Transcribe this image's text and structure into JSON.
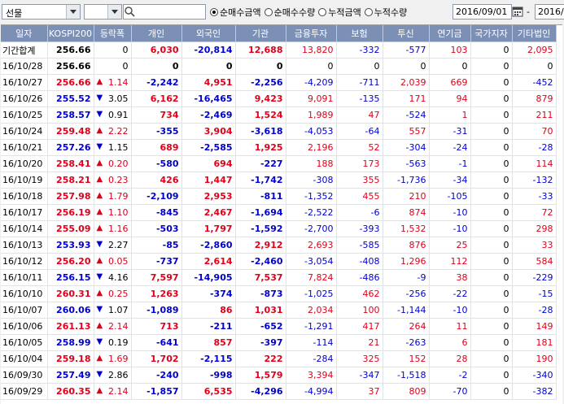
{
  "toolbar": {
    "market_select": "선물",
    "radio_options": [
      {
        "label": "순매수금액",
        "checked": true
      },
      {
        "label": "순매수수량",
        "checked": false
      },
      {
        "label": "누적금액",
        "checked": false
      },
      {
        "label": "누적수량",
        "checked": false
      }
    ],
    "start_date": "2016/09/01",
    "separator": "-",
    "end_date": "2016/"
  },
  "table": {
    "headers": [
      "일자",
      "KOSPI200",
      "등락폭",
      "개인",
      "외국인",
      "기관",
      "금융투자",
      "보험",
      "투신",
      "연기금",
      "국가지자",
      "기타법인"
    ],
    "rows": [
      {
        "d": "기간합계",
        "k": "256.66",
        "dir": "",
        "c": "0",
        "ind": "6,030",
        "for": "-20,814",
        "inst": "12,688",
        "fin": "13,820",
        "ins": "-332",
        "tru": "-577",
        "pen": "103",
        "gov": "0",
        "etc": "2,095"
      },
      {
        "d": "16/10/28",
        "k": "256.66",
        "dir": "",
        "c": "0",
        "ind": "0",
        "for": "0",
        "inst": "0",
        "fin": "0",
        "ins": "0",
        "tru": "0",
        "pen": "0",
        "gov": "0",
        "etc": "0"
      },
      {
        "d": "16/10/27",
        "k": "256.66",
        "dir": "up",
        "c": "1.14",
        "ind": "-2,242",
        "for": "4,951",
        "inst": "-2,256",
        "fin": "-4,209",
        "ins": "-711",
        "tru": "2,039",
        "pen": "669",
        "gov": "0",
        "etc": "-452"
      },
      {
        "d": "16/10/26",
        "k": "255.52",
        "dir": "down",
        "c": "3.05",
        "ind": "6,162",
        "for": "-16,465",
        "inst": "9,423",
        "fin": "9,091",
        "ins": "-135",
        "tru": "171",
        "pen": "94",
        "gov": "0",
        "etc": "879"
      },
      {
        "d": "16/10/25",
        "k": "258.57",
        "dir": "down",
        "c": "0.91",
        "ind": "734",
        "for": "-2,469",
        "inst": "1,524",
        "fin": "1,989",
        "ins": "47",
        "tru": "-524",
        "pen": "1",
        "gov": "0",
        "etc": "211"
      },
      {
        "d": "16/10/24",
        "k": "259.48",
        "dir": "up",
        "c": "2.22",
        "ind": "-355",
        "for": "3,904",
        "inst": "-3,618",
        "fin": "-4,053",
        "ins": "-64",
        "tru": "557",
        "pen": "-31",
        "gov": "0",
        "etc": "70"
      },
      {
        "d": "16/10/21",
        "k": "257.26",
        "dir": "down",
        "c": "1.15",
        "ind": "689",
        "for": "-2,585",
        "inst": "1,925",
        "fin": "2,196",
        "ins": "52",
        "tru": "-304",
        "pen": "-24",
        "gov": "0",
        "etc": "-28"
      },
      {
        "d": "16/10/20",
        "k": "258.41",
        "dir": "up",
        "c": "0.20",
        "ind": "-580",
        "for": "694",
        "inst": "-227",
        "fin": "188",
        "ins": "173",
        "tru": "-563",
        "pen": "-1",
        "gov": "0",
        "etc": "114"
      },
      {
        "d": "16/10/19",
        "k": "258.21",
        "dir": "up",
        "c": "0.23",
        "ind": "426",
        "for": "1,447",
        "inst": "-1,742",
        "fin": "-308",
        "ins": "355",
        "tru": "-1,736",
        "pen": "-34",
        "gov": "0",
        "etc": "-132"
      },
      {
        "d": "16/10/18",
        "k": "257.98",
        "dir": "up",
        "c": "1.79",
        "ind": "-2,109",
        "for": "2,953",
        "inst": "-811",
        "fin": "-1,352",
        "ins": "455",
        "tru": "210",
        "pen": "-105",
        "gov": "0",
        "etc": "-33"
      },
      {
        "d": "16/10/17",
        "k": "256.19",
        "dir": "up",
        "c": "1.10",
        "ind": "-845",
        "for": "2,467",
        "inst": "-1,694",
        "fin": "-2,522",
        "ins": "-6",
        "tru": "874",
        "pen": "-10",
        "gov": "0",
        "etc": "72"
      },
      {
        "d": "16/10/14",
        "k": "255.09",
        "dir": "up",
        "c": "1.16",
        "ind": "-503",
        "for": "1,797",
        "inst": "-1,592",
        "fin": "-2,700",
        "ins": "-393",
        "tru": "1,532",
        "pen": "-10",
        "gov": "0",
        "etc": "298"
      },
      {
        "d": "16/10/13",
        "k": "253.93",
        "dir": "down",
        "c": "2.27",
        "ind": "-85",
        "for": "-2,860",
        "inst": "2,912",
        "fin": "2,693",
        "ins": "-585",
        "tru": "876",
        "pen": "25",
        "gov": "0",
        "etc": "33"
      },
      {
        "d": "16/10/12",
        "k": "256.20",
        "dir": "up",
        "c": "0.05",
        "ind": "-737",
        "for": "2,614",
        "inst": "-2,460",
        "fin": "-3,054",
        "ins": "-408",
        "tru": "1,296",
        "pen": "112",
        "gov": "0",
        "etc": "584"
      },
      {
        "d": "16/10/11",
        "k": "256.15",
        "dir": "down",
        "c": "4.16",
        "ind": "7,597",
        "for": "-14,905",
        "inst": "7,537",
        "fin": "7,824",
        "ins": "-486",
        "tru": "-9",
        "pen": "38",
        "gov": "0",
        "etc": "-229"
      },
      {
        "d": "16/10/10",
        "k": "260.31",
        "dir": "up",
        "c": "0.25",
        "ind": "1,263",
        "for": "-374",
        "inst": "-873",
        "fin": "-1,025",
        "ins": "462",
        "tru": "-256",
        "pen": "-22",
        "gov": "0",
        "etc": "-15"
      },
      {
        "d": "16/10/07",
        "k": "260.06",
        "dir": "down",
        "c": "1.07",
        "ind": "-1,089",
        "for": "86",
        "inst": "1,031",
        "fin": "2,034",
        "ins": "100",
        "tru": "-1,144",
        "pen": "-10",
        "gov": "0",
        "etc": "-28"
      },
      {
        "d": "16/10/06",
        "k": "261.13",
        "dir": "up",
        "c": "2.14",
        "ind": "713",
        "for": "-211",
        "inst": "-652",
        "fin": "-1,291",
        "ins": "417",
        "tru": "264",
        "pen": "11",
        "gov": "0",
        "etc": "149"
      },
      {
        "d": "16/10/05",
        "k": "258.99",
        "dir": "down",
        "c": "0.19",
        "ind": "-641",
        "for": "857",
        "inst": "-397",
        "fin": "-114",
        "ins": "21",
        "tru": "-263",
        "pen": "6",
        "gov": "0",
        "etc": "181"
      },
      {
        "d": "16/10/04",
        "k": "259.18",
        "dir": "up",
        "c": "1.69",
        "ind": "1,702",
        "for": "-2,115",
        "inst": "222",
        "fin": "-284",
        "ins": "325",
        "tru": "152",
        "pen": "28",
        "gov": "0",
        "etc": "190"
      },
      {
        "d": "16/09/30",
        "k": "257.49",
        "dir": "down",
        "c": "2.86",
        "ind": "-240",
        "for": "-998",
        "inst": "1,579",
        "fin": "3,394",
        "ins": "-347",
        "tru": "-1,518",
        "pen": "-2",
        "gov": "0",
        "etc": "-340"
      },
      {
        "d": "16/09/29",
        "k": "260.35",
        "dir": "up",
        "c": "2.14",
        "ind": "-1,857",
        "for": "6,535",
        "inst": "-4,296",
        "fin": "-4,994",
        "ins": "37",
        "tru": "809",
        "pen": "-70",
        "gov": "0",
        "etc": "-382"
      }
    ]
  }
}
